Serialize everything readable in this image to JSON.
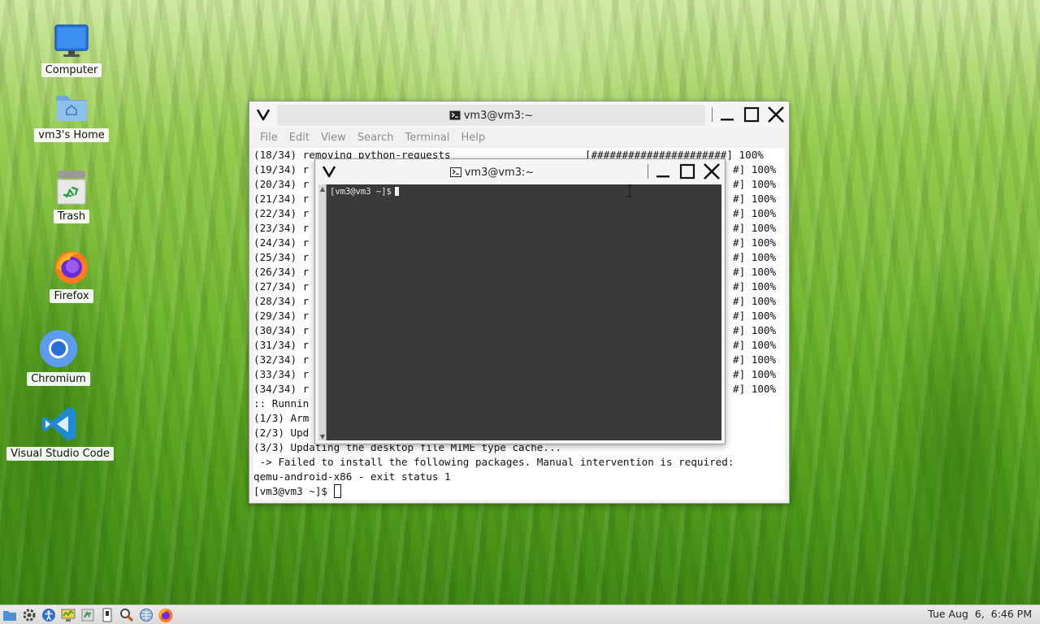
{
  "desktop": {
    "icons": [
      {
        "label": "Computer",
        "icon": "computer-icon"
      },
      {
        "label": "vm3's Home",
        "icon": "home-folder-icon"
      },
      {
        "label": "Trash",
        "icon": "trash-icon"
      },
      {
        "label": "Firefox",
        "icon": "firefox-icon"
      },
      {
        "label": "Chromium",
        "icon": "chromium-icon"
      },
      {
        "label": "Visual Studio Code",
        "icon": "vscode-icon"
      }
    ]
  },
  "back_terminal": {
    "title": "vm3@vm3:~",
    "menu": [
      "File",
      "Edit",
      "View",
      "Search",
      "Terminal",
      "Help"
    ],
    "lines": [
      {
        "left": "(18/34) removing python-requests",
        "right": "[######################] 100%"
      },
      {
        "left": "(19/34) r",
        "right": "#] 100%"
      },
      {
        "left": "(20/34) r",
        "right": "#] 100%"
      },
      {
        "left": "(21/34) r",
        "right": "#] 100%"
      },
      {
        "left": "(22/34) r",
        "right": "#] 100%"
      },
      {
        "left": "(23/34) r",
        "right": "#] 100%"
      },
      {
        "left": "(24/34) r",
        "right": "#] 100%"
      },
      {
        "left": "(25/34) r",
        "right": "#] 100%"
      },
      {
        "left": "(26/34) r",
        "right": "#] 100%"
      },
      {
        "left": "(27/34) r",
        "right": "#] 100%"
      },
      {
        "left": "(28/34) r",
        "right": "#] 100%"
      },
      {
        "left": "(29/34) r",
        "right": "#] 100%"
      },
      {
        "left": "(30/34) r",
        "right": "#] 100%"
      },
      {
        "left": "(31/34) r",
        "right": "#] 100%"
      },
      {
        "left": "(32/34) r",
        "right": "#] 100%"
      },
      {
        "left": "(33/34) r",
        "right": "#] 100%"
      },
      {
        "left": "(34/34) r",
        "right": "#] 100%"
      },
      {
        "left": ":: Runnin",
        "right": ""
      },
      {
        "left": "(1/3) Arm",
        "right": ""
      },
      {
        "left": "(2/3) Upd",
        "right": ""
      },
      {
        "left": "(3/3) Updating the desktop file MIME type cache...",
        "right": ""
      },
      {
        "left": " -> Failed to install the following packages. Manual intervention is required:",
        "right": ""
      },
      {
        "left": "qemu-android-x86 - exit status 1",
        "right": ""
      }
    ],
    "prompt": "[vm3@vm3 ~]$ "
  },
  "front_terminal": {
    "title": "vm3@vm3:~",
    "prompt": "[vm3@vm3 ~]$"
  },
  "taskbar": {
    "launchers": [
      "file-manager-icon",
      "settings-icon",
      "accessibility-icon",
      "system-monitor-icon",
      "power-icon",
      "search-icon",
      "network-icon",
      "firefox-icon"
    ],
    "clock": "Tue Aug  6,  6:46 PM"
  }
}
